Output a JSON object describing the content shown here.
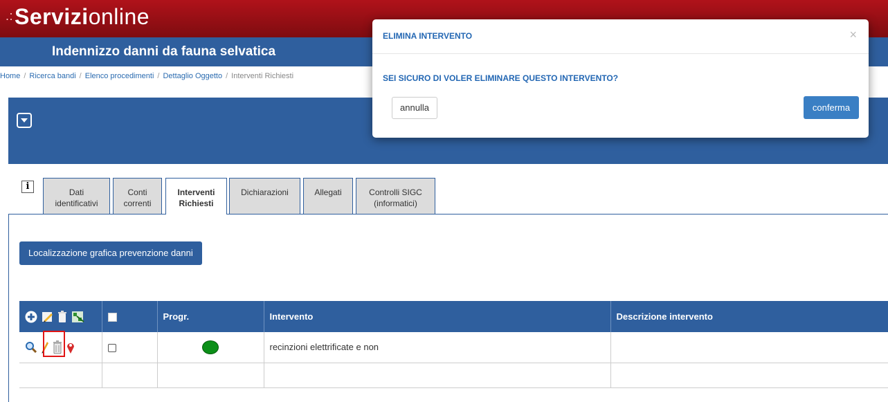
{
  "brand": {
    "dots": ".:",
    "bold": "Servizi",
    "thin": "online"
  },
  "header": {
    "title": "Indennizzo danni da fauna selvatica"
  },
  "breadcrumb": {
    "items": [
      "Home",
      "Ricerca bandi",
      "Elenco procedimenti",
      "Dettaglio Oggetto"
    ],
    "current": "Interventi Richiesti",
    "separator": "/"
  },
  "tabs": [
    {
      "line1": "Dati",
      "line2": "identificativi",
      "active": false
    },
    {
      "line1": "Conti",
      "line2": "correnti",
      "active": false
    },
    {
      "line1": "Interventi",
      "line2": "Richiesti",
      "active": true
    },
    {
      "line1": "Dichiarazioni",
      "line2": "",
      "active": false
    },
    {
      "line1": "Allegati",
      "line2": "",
      "active": false
    },
    {
      "line1": "Controlli SIGC",
      "line2": "(informatici)",
      "active": false
    }
  ],
  "info_icon_text": "i",
  "actions": {
    "localizzazione_label": "Localizzazione grafica prevenzione danni"
  },
  "table": {
    "headers": [
      "",
      "",
      "Progr.",
      "Intervento",
      "Descrizione intervento"
    ],
    "rows": [
      {
        "progr_status": "green",
        "intervento": "recinzioni elettrificate e non",
        "descrizione": ""
      }
    ]
  },
  "modal": {
    "title": "ELIMINA INTERVENTO",
    "close": "×",
    "question": "SEI SICURO DI VOLER ELIMINARE QUESTO INTERVENTO?",
    "cancel_label": "annulla",
    "confirm_label": "conferma"
  },
  "colors": {
    "brand_red": "#b0121a",
    "primary_blue": "#2f5f9e",
    "modal_accent": "#2367b3",
    "confirm_button": "#3a7fc4",
    "status_green": "#0b8f18",
    "highlight_red": "#e01515"
  }
}
